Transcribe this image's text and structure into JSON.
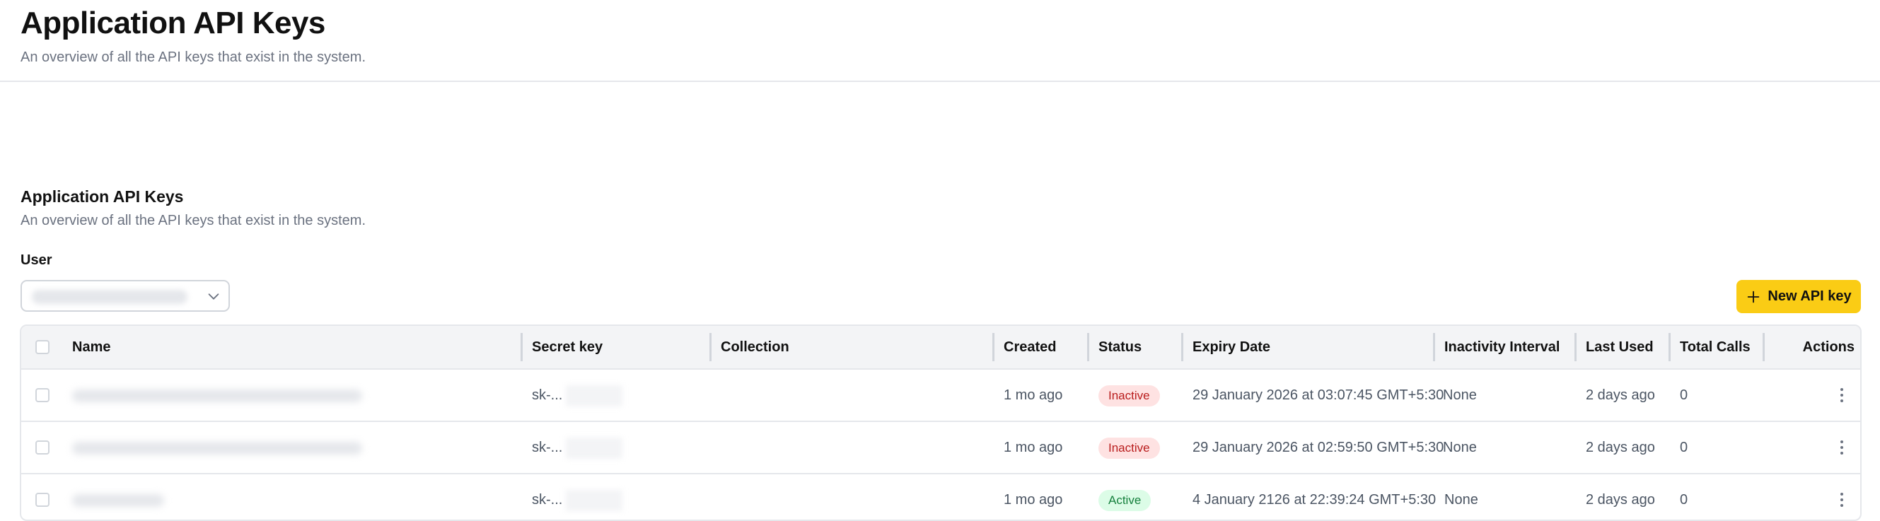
{
  "page": {
    "title": "Application API Keys",
    "subtitle": "An overview of all the API keys that exist in the system."
  },
  "section": {
    "title": "Application API Keys",
    "subtitle": "An overview of all the API keys that exist in the system.",
    "user_label": "User"
  },
  "actions": {
    "new_key_label": "New API key"
  },
  "table": {
    "headers": {
      "name": "Name",
      "secret_key": "Secret key",
      "collection": "Collection",
      "created": "Created",
      "status": "Status",
      "expiry_date": "Expiry Date",
      "inactivity_interval": "Inactivity Interval",
      "last_used": "Last Used",
      "total_calls": "Total Calls",
      "actions": "Actions"
    },
    "rows": [
      {
        "secret_prefix": "sk-...",
        "collection": "",
        "created": "1 mo ago",
        "status": "Inactive",
        "expiry_date": "29 January 2026 at 03:07:45 GMT+5:30",
        "inactivity_interval": "None",
        "last_used": "2 days ago",
        "total_calls": "0"
      },
      {
        "secret_prefix": "sk-...",
        "collection": "",
        "created": "1 mo ago",
        "status": "Inactive",
        "expiry_date": "29 January 2026 at 02:59:50 GMT+5:30",
        "inactivity_interval": "None",
        "last_used": "2 days ago",
        "total_calls": "0"
      },
      {
        "secret_prefix": "sk-...",
        "collection": "",
        "created": "1 mo ago",
        "status": "Active",
        "expiry_date": "4 January 2126 at 22:39:24 GMT+5:30",
        "inactivity_interval": "None",
        "last_used": "2 days ago",
        "total_calls": "0"
      }
    ]
  },
  "colors": {
    "accent": "#facc15",
    "inactive_badge_bg": "#fee2e2",
    "inactive_badge_text": "#b91c1c",
    "active_badge_bg": "#dcfce7",
    "active_badge_text": "#15803d"
  },
  "icons": {
    "select": "chevron-down-icon",
    "new_key": "plus-icon",
    "row_menu": "kebab-menu-icon"
  }
}
